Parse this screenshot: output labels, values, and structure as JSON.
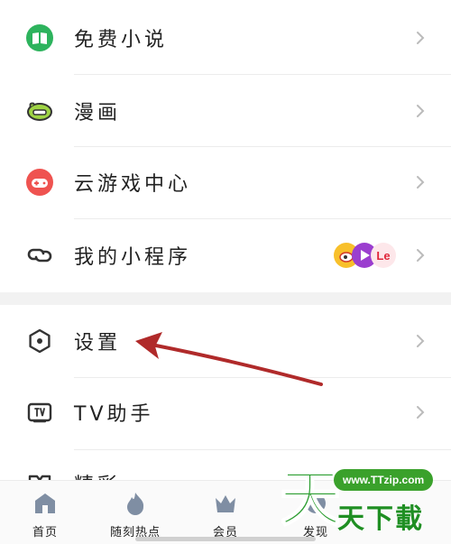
{
  "menu": {
    "items": [
      {
        "label": "免费小说",
        "icon": "book-icon"
      },
      {
        "label": "漫画",
        "icon": "comic-icon"
      },
      {
        "label": "云游戏中心",
        "icon": "gamepad-icon"
      },
      {
        "label": "我的小程序",
        "icon": "mini-program-icon"
      },
      {
        "label": "设置",
        "icon": "settings-icon"
      },
      {
        "label": "TV助手",
        "icon": "tv-icon"
      },
      {
        "label": "精彩",
        "icon": "tag-icon"
      }
    ],
    "mini_app_badges": [
      "weibo-icon",
      "video-play-icon",
      "le-icon"
    ],
    "mini_app_badge_text": "Le"
  },
  "tabbar": {
    "tabs": [
      {
        "label": "首页",
        "icon": "home-icon"
      },
      {
        "label": "随刻热点",
        "icon": "flame-icon"
      },
      {
        "label": "会员",
        "icon": "crown-icon"
      },
      {
        "label": "发现",
        "icon": "discover-icon"
      }
    ]
  },
  "watermark": {
    "url": "www.TTzip.com",
    "text": "天下載",
    "logo_char": "天"
  },
  "colors": {
    "green": "#2db35d",
    "red_arrow": "#b02a2a",
    "watermark_green": "#2a9d2f"
  }
}
